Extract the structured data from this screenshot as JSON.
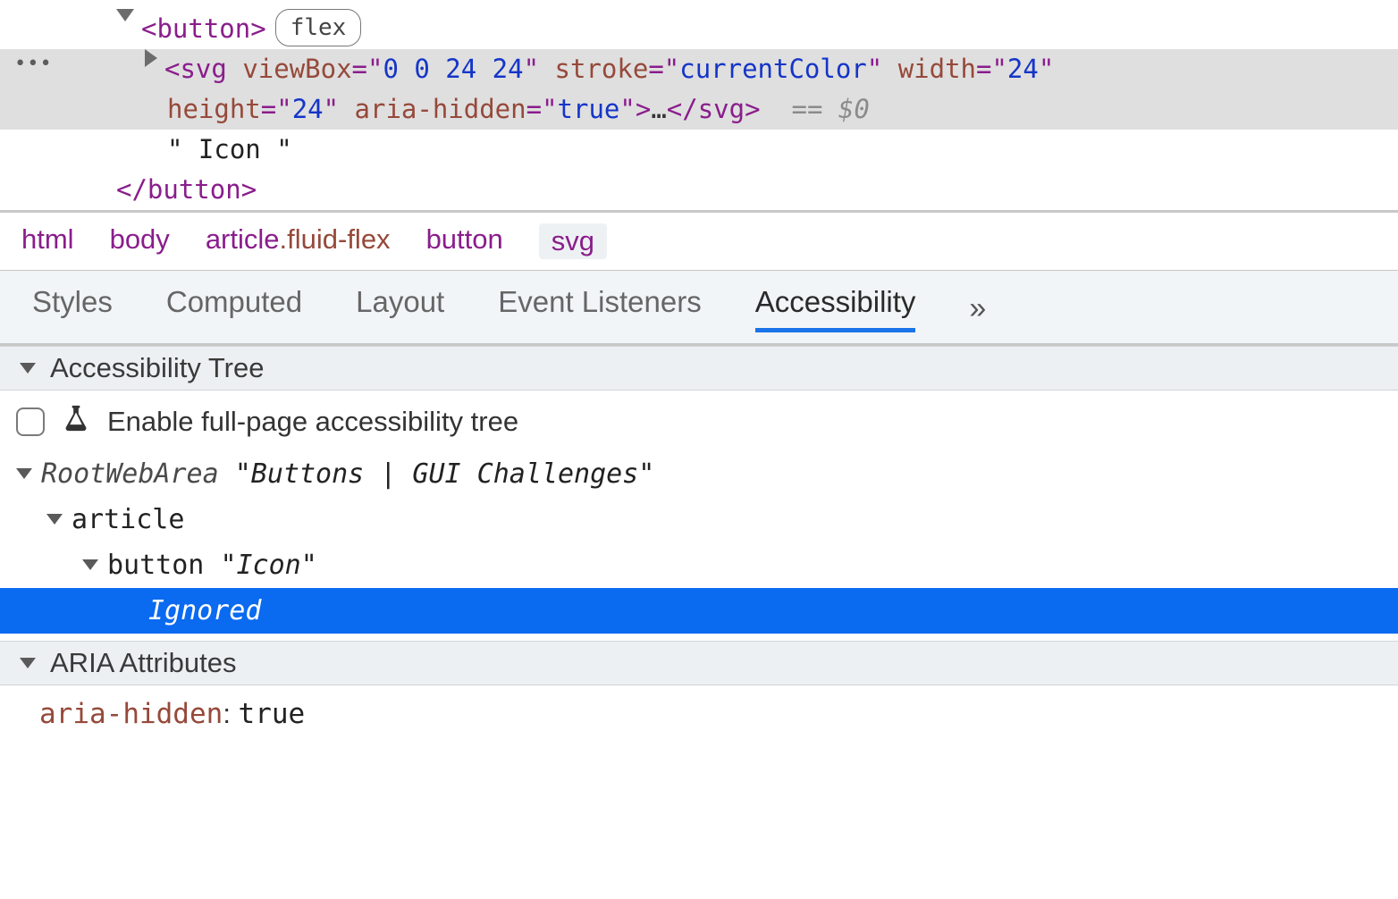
{
  "dom": {
    "button_open": "<button>",
    "button_close": "</button>",
    "flex_badge": "flex",
    "svg_tag": "svg",
    "svg_attrs": {
      "viewBox_name": "viewBox",
      "viewBox_val": "0 0 24 24",
      "stroke_name": "stroke",
      "stroke_val": "currentColor",
      "width_name": "width",
      "width_val": "24",
      "height_name": "height",
      "height_val": "24",
      "aria_hidden_name": "aria-hidden",
      "aria_hidden_val": "true"
    },
    "svg_ellipsis": "…",
    "svg_close": "</svg>",
    "eq0": "== $0",
    "text_node": "\" Icon \""
  },
  "breadcrumb": {
    "items": [
      "html",
      "body",
      "article.fluid-flex",
      "button",
      "svg"
    ]
  },
  "tabs": {
    "items": [
      "Styles",
      "Computed",
      "Layout",
      "Event Listeners",
      "Accessibility"
    ],
    "more": "»"
  },
  "acc": {
    "tree_header": "Accessibility Tree",
    "enable_label": "Enable full-page accessibility tree",
    "tree": {
      "root_role": "RootWebArea",
      "root_name": "\"Buttons | GUI Challenges\"",
      "article_role": "article",
      "button_role": "button",
      "button_name": "\"Icon\"",
      "ignored": "Ignored"
    },
    "aria_header": "ARIA Attributes",
    "aria_attr_key": "aria-hidden",
    "aria_attr_val": "true"
  }
}
